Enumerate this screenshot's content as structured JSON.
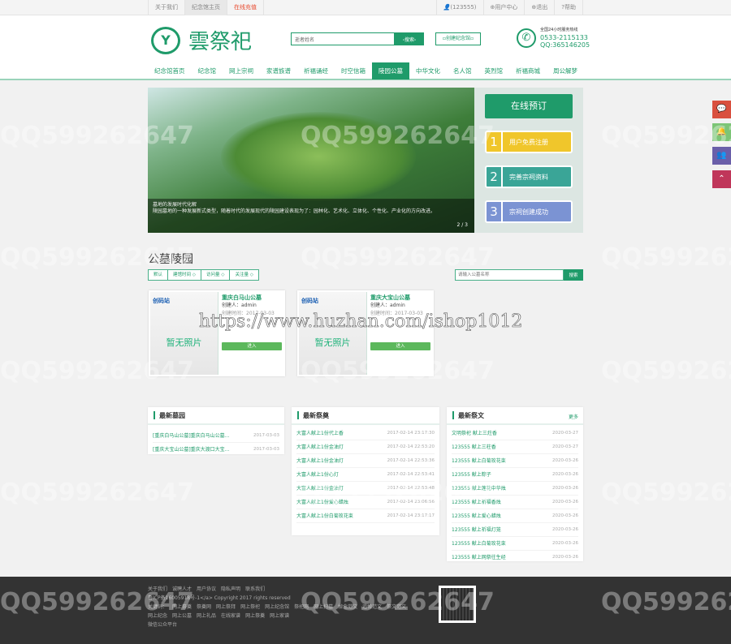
{
  "topbar": {
    "left": [
      "关于我们",
      "纪念馆主页",
      "在线充值"
    ],
    "user": "(123555)",
    "right": [
      "用户中心",
      "退出",
      "帮助"
    ]
  },
  "header": {
    "logo_mark": "Y",
    "logo_name": "雲祭祀",
    "search_placeholder": "逝者姓名",
    "search_button": "▫搜索▫",
    "create_button": "▫创建纪念馆▫",
    "hotline_label": "全国24小时服务热线",
    "phone": "0533-2115133",
    "qq": "QQ:365146205"
  },
  "nav": [
    "纪念馆首页",
    "纪念馆",
    "网上宗祠",
    "家谱族谱",
    "祈福诵经",
    "时空信箱",
    "陵园公墓",
    "中华文化",
    "名人馆",
    "英烈馆",
    "祈福商城",
    "周公解梦"
  ],
  "nav_active": 6,
  "banner": {
    "caption_title": "墓地的发展时代化解",
    "caption_text": "陵园墓地的一种发展新式类型，随着时代的发展现代的陵园建设表现为了：园林化、艺术化、立体化、个性化、产业化的方向改进。",
    "pager": "2 / 3"
  },
  "booking": {
    "title": "在线预订",
    "steps": [
      {
        "n": "1",
        "label": "用户免费注册",
        "color": "#f0c62b"
      },
      {
        "n": "2",
        "label": "完善宗祠资料",
        "color": "#3aa597"
      },
      {
        "n": "3",
        "label": "宗祠创建成功",
        "color": "#7b93d3"
      }
    ]
  },
  "section_title": "公墓陵园",
  "filters": [
    "默认",
    "建馆时间 ◇",
    "访问量 ◇",
    "关注量 ◇"
  ],
  "filter_search": {
    "placeholder": "请输入公墓名称",
    "button": "搜索"
  },
  "cards": [
    {
      "logo": "创码站",
      "no_photo": "暂无照片",
      "title": "重庆白马山公墓",
      "creator": "创建人：admin",
      "time": "创建时间：2017-03-03",
      "enter": "进入"
    },
    {
      "logo": "创码站",
      "no_photo": "暂无照片",
      "title": "重庆大宝山公墓",
      "creator": "创建人：admin",
      "time": "创建时间：2017-03-03",
      "enter": "进入"
    }
  ],
  "latest_cemetery": {
    "title": "最新墓园",
    "items": [
      {
        "t": "[重庆白马山公墓]重庆白马山公墓...",
        "d": "2017-03-03"
      },
      {
        "t": "[重庆大宝山公墓]重庆大渡口大宝...",
        "d": "2017-03-03"
      }
    ]
  },
  "latest_offering": {
    "title": "最新祭奠",
    "items": [
      {
        "t": "大富人献上1份代上香",
        "d": "2017-02-14 23:17:30"
      },
      {
        "t": "大富人献上1份金油灯",
        "d": "2017-02-14 22:53:20"
      },
      {
        "t": "大富人献上1份金油灯",
        "d": "2017-02-14 22:53:36"
      },
      {
        "t": "大富人献上1份心灯",
        "d": "2017-02-14 22:53:41"
      },
      {
        "t": "大富人献上1份金油灯",
        "d": "2017-02-14 22:53:48"
      },
      {
        "t": "大富人献上1份爱心蜡烛",
        "d": "2017-02-14 23:06:56"
      },
      {
        "t": "大富人献上1份白菊玫花束",
        "d": "2017-02-14 23:17:17"
      }
    ]
  },
  "latest_article": {
    "title": "最新祭文",
    "more": "更多",
    "items": [
      {
        "t": "文明祭祀 献上三炷香",
        "d": "2020-03-27"
      },
      {
        "t": "123555 献上三柱香",
        "d": "2020-03-27"
      },
      {
        "t": "123555 献上白菊玫花束",
        "d": "2020-03-26"
      },
      {
        "t": "123555 献上粽子",
        "d": "2020-03-26"
      },
      {
        "t": "123555 献上莲花中华烛",
        "d": "2020-03-26"
      },
      {
        "t": "123555 献上祈福香烛",
        "d": "2020-03-26"
      },
      {
        "t": "123555 献上爱心蜡烛",
        "d": "2020-03-26"
      },
      {
        "t": "123555 献上祈福灯笼",
        "d": "2020-03-26"
      },
      {
        "t": "123555 献上白菊玫花束",
        "d": "2020-03-26"
      },
      {
        "t": "123555 献上网祭往生经",
        "d": "2020-03-26"
      }
    ]
  },
  "footer": {
    "links": [
      "关于我们",
      "诚聘人才",
      "用户协议",
      "隐私声明",
      "联系我们"
    ],
    "copyright": "鲁ICP备16005918号-1</a> Copyright 2017 rights reserved",
    "keywords_label": "关键词：",
    "keywords": [
      "网上祭奠",
      "祭奠网",
      "网上祭拜",
      "网上祭祀",
      "网上纪念馆",
      "祭祀网",
      "网上扫墓",
      "悼念范文",
      "追悼范文",
      "祭文范文"
    ],
    "keywords2": [
      "网上纪念",
      "网上公墓",
      "网上礼品",
      "在线家谱",
      "网上祭奠",
      "网上家谱"
    ],
    "wechat": "微信公众平台"
  },
  "float_icons": [
    "chat-icon",
    "qq-icon",
    "users-icon",
    "back-to-top-icon"
  ],
  "watermark": "QQ599262647",
  "url_watermark": "https://www.huzhan.com/ishop1012"
}
